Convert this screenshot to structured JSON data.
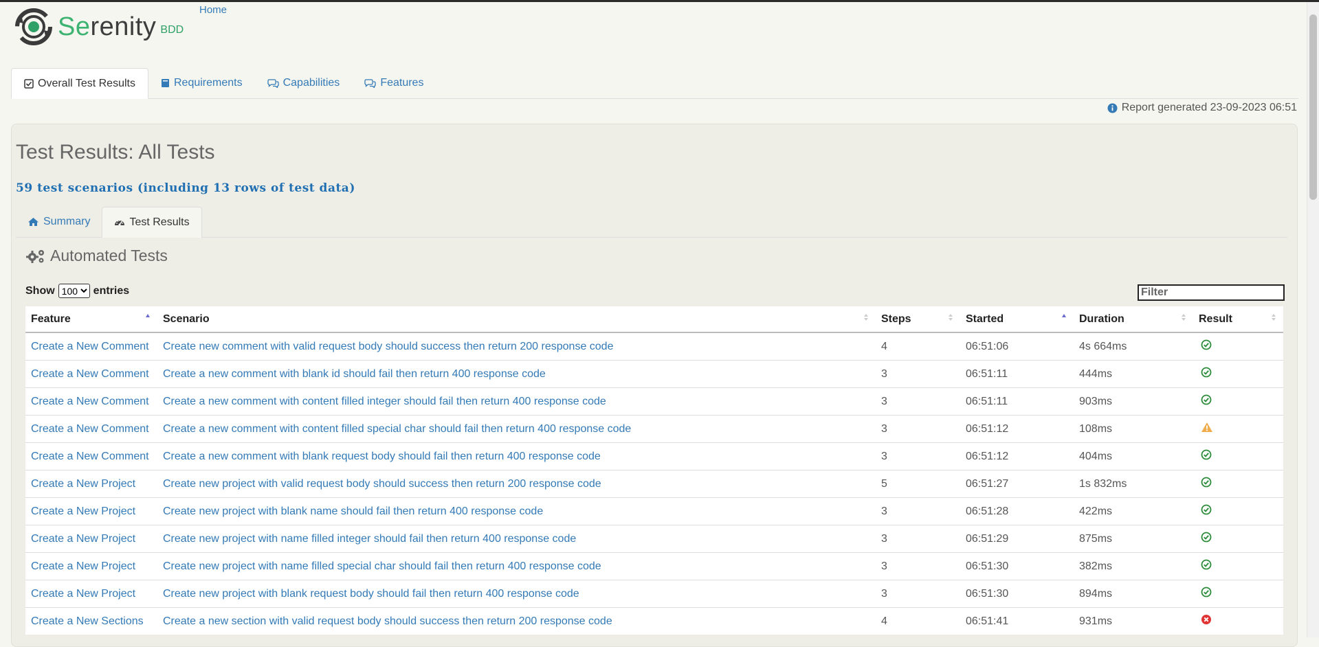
{
  "header": {
    "logo_text_accent": "Se",
    "logo_text_rest": "renity",
    "logo_suffix": "BDD",
    "home_link": "Home"
  },
  "main_tabs": [
    {
      "label": "Overall Test Results",
      "icon": "check-square-icon",
      "active": true
    },
    {
      "label": "Requirements",
      "icon": "book-icon",
      "active": false
    },
    {
      "label": "Capabilities",
      "icon": "comments-icon",
      "active": false
    },
    {
      "label": "Features",
      "icon": "comments-icon",
      "active": false
    }
  ],
  "report_generated": "Report generated 23-09-2023 06:51",
  "page_title": "Test Results: All Tests",
  "scenario_count": "59 test scenarios (including 13 rows of test data)",
  "sub_tabs": [
    {
      "label": "Summary",
      "icon": "home-icon",
      "active": false
    },
    {
      "label": "Test Results",
      "icon": "dashboard-icon",
      "active": true
    }
  ],
  "section_title": "Automated Tests",
  "entries": {
    "show_label": "Show",
    "selected": "100",
    "entries_label": "entries",
    "filter_placeholder": "Filter"
  },
  "table": {
    "columns": [
      "Feature",
      "Scenario",
      "Steps",
      "Started",
      "Duration",
      "Result"
    ],
    "rows": [
      {
        "feature": "Create a New Comment",
        "scenario": "Create new comment with valid request body should success then return 200 response code",
        "steps": "4",
        "started": "06:51:06",
        "duration": "4s 664ms",
        "result": "success"
      },
      {
        "feature": "Create a New Comment",
        "scenario": "Create a new comment with blank id should fail then return 400 response code",
        "steps": "3",
        "started": "06:51:11",
        "duration": "444ms",
        "result": "success"
      },
      {
        "feature": "Create a New Comment",
        "scenario": "Create a new comment with content filled integer should fail then return 400 response code",
        "steps": "3",
        "started": "06:51:11",
        "duration": "903ms",
        "result": "success"
      },
      {
        "feature": "Create a New Comment",
        "scenario": "Create a new comment with content filled special char should fail then return 400 response code",
        "steps": "3",
        "started": "06:51:12",
        "duration": "108ms",
        "result": "warning"
      },
      {
        "feature": "Create a New Comment",
        "scenario": "Create a new comment with blank request body should fail then return 400 response code",
        "steps": "3",
        "started": "06:51:12",
        "duration": "404ms",
        "result": "success"
      },
      {
        "feature": "Create a New Project",
        "scenario": "Create new project with valid request body should success then return 200 response code",
        "steps": "5",
        "started": "06:51:27",
        "duration": "1s 832ms",
        "result": "success"
      },
      {
        "feature": "Create a New Project",
        "scenario": "Create new project with blank name should fail then return 400 response code",
        "steps": "3",
        "started": "06:51:28",
        "duration": "422ms",
        "result": "success"
      },
      {
        "feature": "Create a New Project",
        "scenario": "Create new project with name filled integer should fail then return 400 response code",
        "steps": "3",
        "started": "06:51:29",
        "duration": "875ms",
        "result": "success"
      },
      {
        "feature": "Create a New Project",
        "scenario": "Create new project with name filled special char should fail then return 400 response code",
        "steps": "3",
        "started": "06:51:30",
        "duration": "382ms",
        "result": "success"
      },
      {
        "feature": "Create a New Project",
        "scenario": "Create new project with blank request body should fail then return 400 response code",
        "steps": "3",
        "started": "06:51:30",
        "duration": "894ms",
        "result": "success"
      },
      {
        "feature": "Create a New Sections",
        "scenario": "Create a new section with valid request body should success then return 200 response code",
        "steps": "4",
        "started": "06:51:41",
        "duration": "931ms",
        "result": "failure"
      }
    ]
  },
  "colors": {
    "link": "#337ab7",
    "success": "#2e8b3a",
    "warning": "#f0ad4e",
    "failure": "#e03434",
    "brand": "#3cb371"
  }
}
